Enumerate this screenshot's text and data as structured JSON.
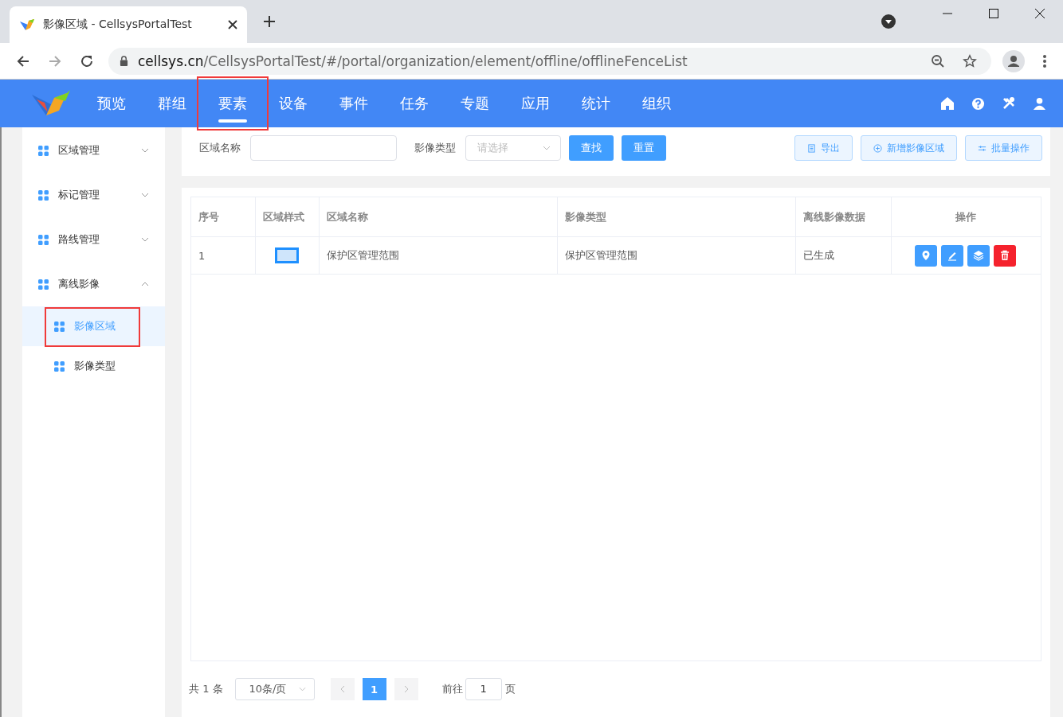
{
  "browser": {
    "tab_title": "影像区域 - CellsysPortalTest",
    "url_host": "cellsys.cn",
    "url_path": "/CellsysPortalTest/#/portal/organization/element/offline/offlineFenceList"
  },
  "nav": [
    {
      "label": "预览",
      "selected": false,
      "annotated": false
    },
    {
      "label": "群组",
      "selected": false,
      "annotated": false
    },
    {
      "label": "要素",
      "selected": true,
      "annotated": true
    },
    {
      "label": "设备",
      "selected": false,
      "annotated": false
    },
    {
      "label": "事件",
      "selected": false,
      "annotated": false
    },
    {
      "label": "任务",
      "selected": false,
      "annotated": false
    },
    {
      "label": "专题",
      "selected": false,
      "annotated": false
    },
    {
      "label": "应用",
      "selected": false,
      "annotated": false
    },
    {
      "label": "统计",
      "selected": false,
      "annotated": false
    },
    {
      "label": "组织",
      "selected": false,
      "annotated": false
    }
  ],
  "sidebar": [
    {
      "label": "区域管理",
      "expanded": false
    },
    {
      "label": "标记管理",
      "expanded": false
    },
    {
      "label": "路线管理",
      "expanded": false
    },
    {
      "label": "离线影像",
      "expanded": true,
      "children": [
        {
          "label": "影像区域",
          "selected": true,
          "annotated": true
        },
        {
          "label": "影像类型",
          "selected": false,
          "annotated": false
        }
      ]
    }
  ],
  "filters": {
    "name_label": "区域名称",
    "type_label": "影像类型",
    "type_placeholder": "请选择",
    "search": "查找",
    "reset": "重置"
  },
  "toolbar": [
    {
      "kind": "export",
      "label": "导出"
    },
    {
      "kind": "add",
      "label": "新增影像区域"
    },
    {
      "kind": "batch",
      "label": "批量操作"
    }
  ],
  "table": {
    "columns": [
      "序号",
      "区域样式",
      "区域名称",
      "影像类型",
      "离线影像数据",
      "操作"
    ],
    "rows": [
      {
        "index": "1",
        "name": "保护区管理范围",
        "type": "保护区管理范围",
        "data": "已生成",
        "actions": [
          {
            "kind": "locate"
          },
          {
            "kind": "edit"
          },
          {
            "kind": "layers"
          },
          {
            "kind": "delete"
          }
        ]
      }
    ]
  },
  "pagination": {
    "total": "共 1 条",
    "page_size": "10条/页",
    "pages": [
      {
        "label": "1",
        "selected": true
      }
    ],
    "goto_label": "前往",
    "goto_value": "1",
    "page_suffix": "页"
  }
}
